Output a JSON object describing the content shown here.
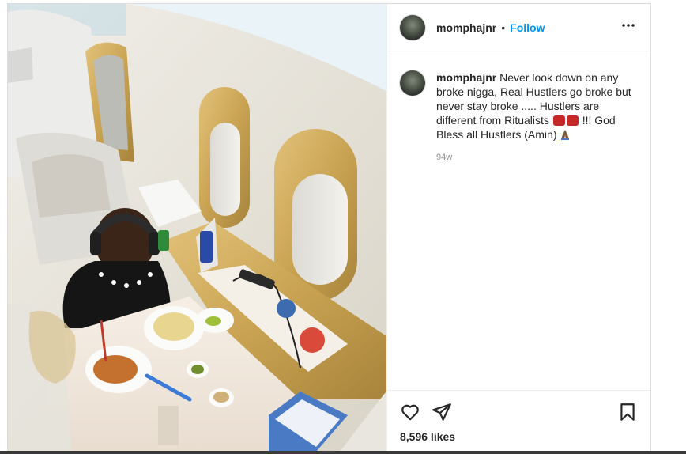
{
  "post": {
    "username": "momphajnr",
    "dot": "•",
    "follow_label": "Follow",
    "more_label": "•••",
    "caption": {
      "username": "momphajnr",
      "text_part1": "Never look down on any broke nigga, Real Hustlers go broke but never stay broke ..... Hustlers are different from Ritualists",
      "text_part2": "!!! God Bless all Hustlers (Amin)"
    },
    "time_ago": "94w",
    "likes": "8,596 likes"
  },
  "icons": {
    "like": "heart-icon",
    "share": "send-icon",
    "save": "bookmark-icon",
    "more": "more-icon",
    "caption_emoji": "hundred-points-icon",
    "prayer_emoji": "folded-hands-icon"
  },
  "colors": {
    "accent": "#0095f6",
    "text": "#262626",
    "muted": "#8e8e8e",
    "border": "#dbdbdb"
  }
}
